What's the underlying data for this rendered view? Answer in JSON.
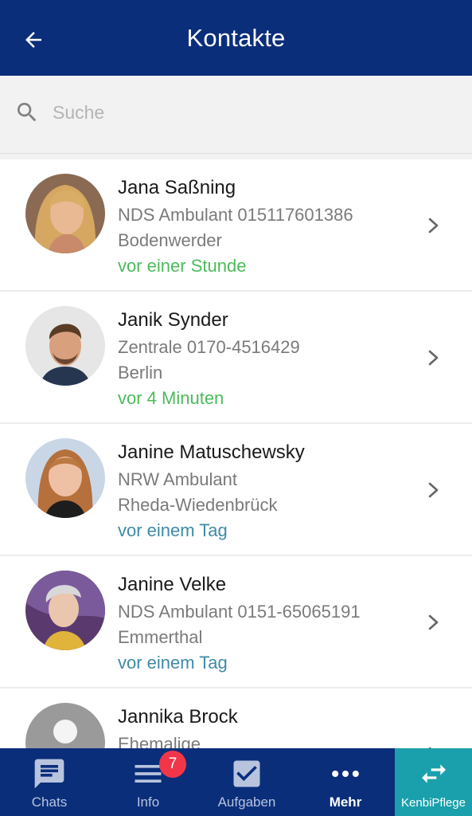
{
  "header": {
    "title": "Kontakte",
    "back_icon": "arrow-left-icon"
  },
  "search": {
    "placeholder": "Suche",
    "value": ""
  },
  "colors": {
    "header_bg": "#0a2e7a",
    "online": "#4cbb5b",
    "offline": "#3e8ba8",
    "badge": "#f2364a",
    "accent_tab": "#1aa0ac"
  },
  "contacts": [
    {
      "name": "Jana Saßning",
      "line1": "NDS Ambulant  015117601386",
      "line2": "Bodenwerder",
      "last_seen": "vor einer Stunde",
      "status": "online"
    },
    {
      "name": "Janik Synder",
      "line1": "Zentrale  0170-4516429",
      "line2": "Berlin",
      "last_seen": "vor 4 Minuten",
      "status": "online"
    },
    {
      "name": "Janine Matuschewsky",
      "line1": "NRW Ambulant",
      "line2": "Rheda-Wiedenbrück",
      "last_seen": "vor einem Tag",
      "status": "offline"
    },
    {
      "name": "Janine Velke",
      "line1": "NDS Ambulant  0151-65065191",
      "line2": "Emmerthal",
      "last_seen": "vor einem Tag",
      "status": "offline"
    },
    {
      "name": "Jannika Brock",
      "line1": "Ehemalige",
      "line2": "",
      "last_seen": "",
      "status": "offline"
    }
  ],
  "tabs": [
    {
      "label": "Chats",
      "icon": "chat-icon"
    },
    {
      "label": "Info",
      "icon": "list-icon",
      "badge": "7"
    },
    {
      "label": "Aufgaben",
      "icon": "checkbox-icon"
    },
    {
      "label": "Mehr",
      "icon": "more-icon"
    },
    {
      "label": "KenbiPflege",
      "icon": "switch-arrows-icon"
    }
  ]
}
